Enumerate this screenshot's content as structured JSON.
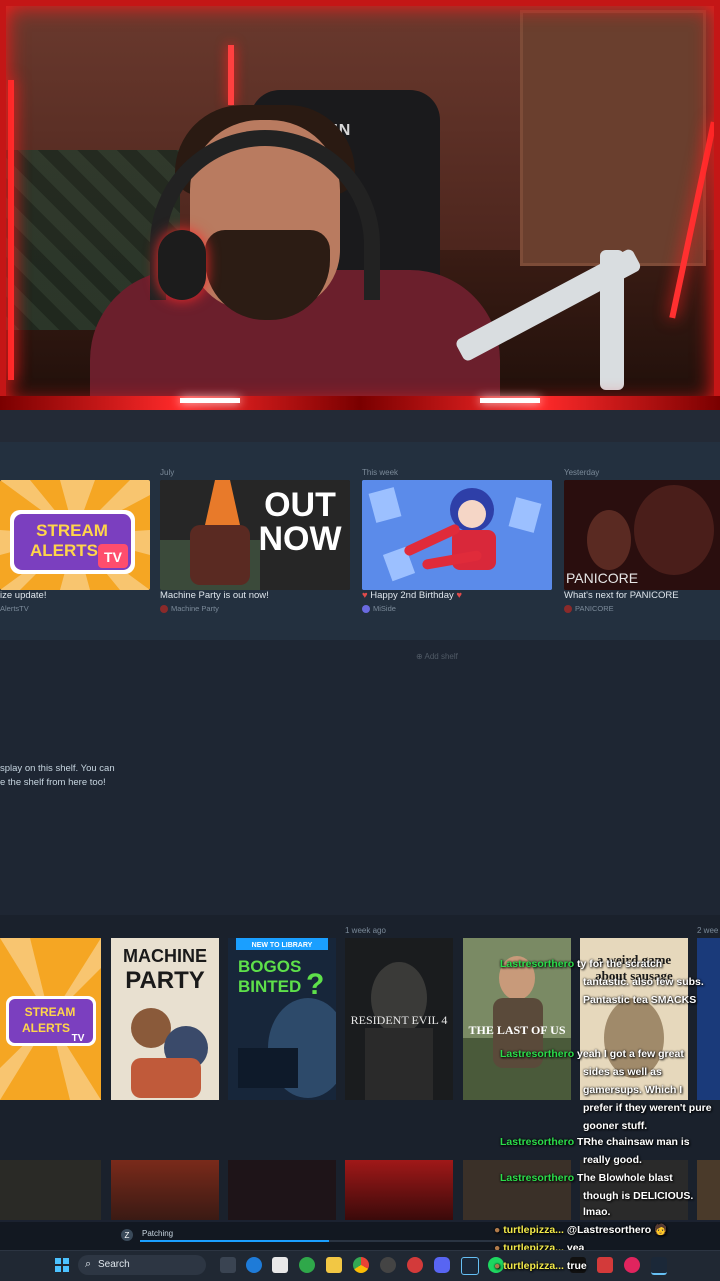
{
  "shelf1": {
    "cards": [
      {
        "when": "",
        "title": "ize update!",
        "author": "AlertsTV",
        "art": "STREAM ALERTS TV",
        "color": "#f5a623"
      },
      {
        "when": "July",
        "title": "Machine Party is out now!",
        "author": "Machine Party",
        "art": "OUT NOW",
        "color": "#2a2a2a"
      },
      {
        "when": "This week",
        "title": "Happy 2nd Birthday",
        "author": "MiSide",
        "art": "",
        "color": "#3b6fd8"
      },
      {
        "when": "Yesterday",
        "title": "What's next for PANICORE",
        "author": "PANICORE",
        "art": "PANICORE",
        "color": "#3a1414"
      }
    ]
  },
  "add_shelf": "Add shelf",
  "empty_message": [
    "splay on this shelf. You can",
    "e the shelf from here too!"
  ],
  "shelf2": {
    "week_label": "1 week ago",
    "week_label2": "2 wee",
    "games": [
      {
        "title": "STREAM ALERTS TV",
        "color": "#f5a623"
      },
      {
        "title": "MACHINE PARTY",
        "color": "#e8e0d0"
      },
      {
        "title": "BOGOS BINTED?",
        "badge": "NEW TO LIBRARY",
        "color": "#1b2a3a"
      },
      {
        "title": "RESIDENT EVIL 4",
        "color": "#222222"
      },
      {
        "title": "THE LAST OF US",
        "color": "#5a6a4a"
      },
      {
        "title": "a weird game about sausage",
        "color": "#e0d2b8"
      }
    ]
  },
  "chat": [
    {
      "user": "Lastresortherо",
      "msg": "ty for the scratch"
    },
    {
      "user": "",
      "msg": "tantastic. also few subs."
    },
    {
      "user": "Lastresortherо",
      "msg": "Pantastic tea SMACKS"
    },
    {
      "user": "Lastresortherо",
      "msg": "yeah I got a few great"
    },
    {
      "user": "",
      "msg": "sides as well as"
    },
    {
      "user": "",
      "msg": "gamersups. Which I"
    },
    {
      "user": "",
      "msg": "prefer if they weren't pure"
    },
    {
      "user": "",
      "msg": "gooner stuff."
    },
    {
      "user": "Lastresortherо",
      "msg": "TRhe chainsaw man is"
    },
    {
      "user": "",
      "msg": "really good."
    },
    {
      "user": "Lastresortherо",
      "msg": "The Blowhole blast"
    },
    {
      "user": "",
      "msg": "though is DELICIOUS."
    },
    {
      "user": "",
      "msg": "lmao."
    },
    {
      "user": "turtlepizza...",
      "msg": "@Lastresortherо 🧑"
    },
    {
      "user": "turtlepizza...",
      "msg": "yea"
    },
    {
      "user": "turtlepizza...",
      "msg": "true"
    }
  ],
  "patching": {
    "label": "Patching",
    "progress": 0.46
  },
  "taskbar": {
    "search_label": "Search"
  },
  "colors": {
    "accent": "#1a9fff",
    "frame": "#e01b1b",
    "chat_user": "#2bdc4a"
  }
}
